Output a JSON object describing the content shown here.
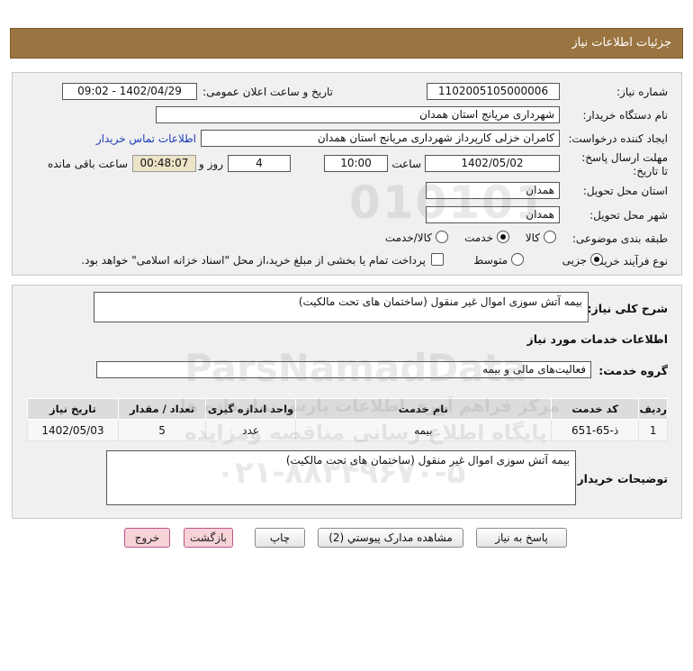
{
  "header": {
    "title": "جزئیات اطلاعات نیاز"
  },
  "info": {
    "need_number_label": "شماره نیاز:",
    "need_number": "1102005105000006",
    "announce_label": "تاریخ و ساعت اعلان عمومی:",
    "announce_value": "1402/04/29 - 09:02",
    "buyer_org_label": "نام دستگاه خریدار:",
    "buyer_org": "شهرداری مریانج استان همدان",
    "requester_label": "ایجاد کننده درخواست:",
    "requester": "کامران خزلی کارپرداز شهرداری مریانج استان همدان",
    "contact_link": "اطلاعات تماس خریدار",
    "deadline_label": "مهلت ارسال پاسخ: تا تاریخ:",
    "deadline_date": "1402/05/02",
    "time_label": "ساعت",
    "deadline_time": "10:00",
    "days_value": "4",
    "days_label": "روز و",
    "remaining_time": "00:48:07",
    "remaining_label": "ساعت باقی مانده",
    "province_label": "استان محل تحویل:",
    "province": "همدان",
    "city_label": "شهر محل تحویل:",
    "city": "همدان",
    "category_label": "طبقه بندی موضوعی:",
    "category_options": [
      "کالا",
      "خدمت",
      "کالا/خدمت"
    ],
    "category_selected": "خدمت",
    "process_label": "نوع فرآیند خرید :",
    "process_options": [
      "جزیی",
      "متوسط"
    ],
    "process_selected": "جزیی",
    "payment_note": "پرداخت تمام یا بخشی از مبلغ خرید،از محل \"اسناد خزانه اسلامی\" خواهد بود."
  },
  "details": {
    "summary_label": "شرح کلی نیاز:",
    "summary": "بیمه آتش سوزی اموال غیر منقول (ساختمان های تحت مالکیت)",
    "services_title": "اطلاعات خدمات مورد نیاز",
    "service_group_label": "گروه خدمت:",
    "service_group": "فعالیت‌های مالی و بیمه",
    "table": {
      "headers": [
        "ردیف",
        "کد خدمت",
        "نام خدمت",
        "واحد اندازه گیری",
        "تعداد / مقدار",
        "تاریخ نیاز"
      ],
      "rows": [
        [
          "1",
          "ذ-65-651",
          "بیمه",
          "عدد",
          "5",
          "1402/05/03"
        ]
      ]
    },
    "buyer_notes_label": "توضیحات خریدار:",
    "buyer_notes": "بیمه آتش سوزی اموال غیر منقول (ساختمان های تحت مالکیت)"
  },
  "buttons": {
    "reply": "پاسخ به نیاز",
    "attachments": "مشاهده مدارک پیوستي (2)",
    "print": "چاپ",
    "back": "بازگشت",
    "exit": "خروج"
  },
  "watermark": {
    "digits": "010101",
    "brand": "ParsNamadData",
    "line1": "مرکز فراهم آوری اطلاعات پارس نماد داده ها",
    "line2": "پایگاه اطلاع رسانی مناقصه ومزایده",
    "phone": "۰۲۱-۸۸۳۴۹۶۷۰-۵"
  }
}
